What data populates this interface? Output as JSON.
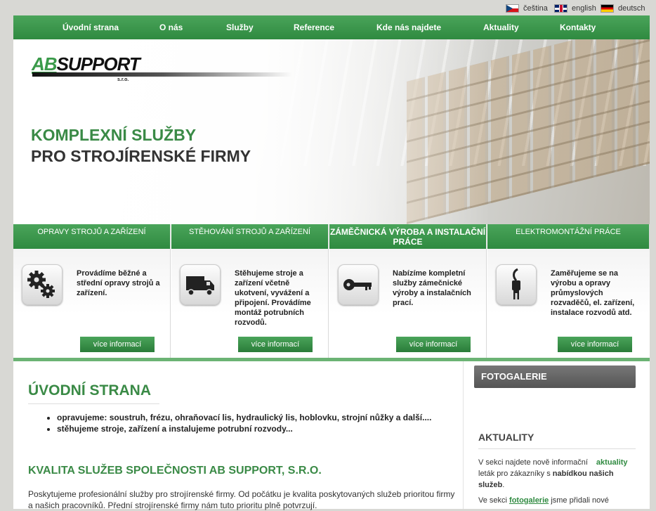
{
  "langs": [
    {
      "label": "čeština",
      "flag": "czech-flag"
    },
    {
      "label": "english",
      "flag": "uk-flag"
    },
    {
      "label": "deutsch",
      "flag": "german-flag"
    }
  ],
  "nav": [
    "Úvodní strana",
    "O nás",
    "Služby",
    "Reference",
    "Kde nás najdete",
    "Aktuality",
    "Kontakty"
  ],
  "banner": {
    "logo_main": "SUPPORT",
    "logo_ab": "AB",
    "logo_sro": "s.r.o.",
    "slogan_line1": "KOMPLEXNÍ SLUŽBY",
    "slogan_line2": "PRO STROJÍRENSKÉ FIRMY"
  },
  "services": [
    {
      "title": "OPRAVY STROJŮ A ZAŘÍZENÍ",
      "text": "Provádíme běžné a střední opravy strojů a zařízení.",
      "button": "více informací",
      "icon": "gears-icon"
    },
    {
      "title": "STĚHOVÁNÍ STROJŮ A ZAŘÍZENÍ",
      "text": "Stěhujeme stroje a zařízení včetně ukotvení, vyvážení a připojení. Provádíme montáž potrubních rozvodů.",
      "button": "více informací",
      "icon": "truck-icon"
    },
    {
      "title": "ZÁMĚČNICKÁ VÝROBA A INSTALAČNÍ PRÁCE",
      "text": "Nabízíme kompletní služby zámečnické výroby a instalačních prací.",
      "button": "více informací",
      "icon": "key-icon"
    },
    {
      "title": "ELEKTROMONTÁŽNÍ PRÁCE",
      "text": "Zaměřujeme se na výrobu a opravy průmyslových rozvaděčů, el. zařízení, instalace rozvodů atd.",
      "button": "více informací",
      "icon": "plug-icon"
    }
  ],
  "main": {
    "heading": "ÚVODNÍ STRANA",
    "bullets": [
      "opravujeme: soustruh, frézu, ohraňovací lis, hydraulický lis, hoblovku, strojní nůžky a další....",
      "stěhujeme stroje, zařízení a instalujeme potrubní rozvody..."
    ],
    "heading2": "KVALITA SLUŽEB SPOLEČNOSTI AB SUPPORT, S.R.O.",
    "paragraph": "Poskytujeme profesionální služby pro strojírenské firmy. Od počátku je kvalita poskytovaných služeb prioritou firmy a našich pracovníků. Přední strojírenské firmy nám tuto prioritu plně potvrzují."
  },
  "sidebar": {
    "gallery": "FOTOGALERIE",
    "news_title": "AKTUALITY",
    "news_text_1": "V sekci najdete nově informační",
    "news_link": "aktuality",
    "news_text_2": "leták pro zákazníky s",
    "news_bold": "nabídkou našich služeb",
    "news_text_3": ".",
    "more_prefix": "Ve sekci",
    "more_link": "fotogalerie",
    "more_suffix": "jsme přidali nové"
  }
}
